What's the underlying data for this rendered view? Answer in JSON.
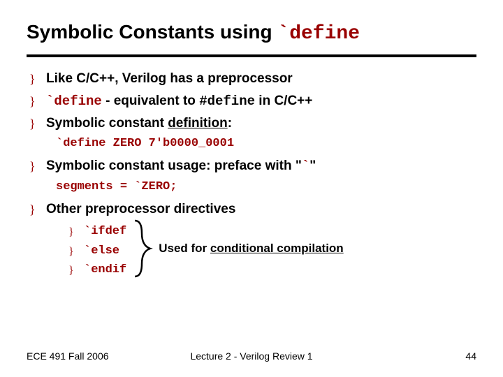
{
  "title": {
    "prefix": "Symbolic Constants using ",
    "code": "`define"
  },
  "bullets": {
    "b1": "Like C/C++, Verilog has a preprocessor",
    "b2": {
      "code1": "`define",
      "mid": " - equivalent to ",
      "code2": "#define",
      "tail": " in C/C++"
    },
    "b3": {
      "pre": "Symbolic constant ",
      "u": "definition",
      "post": ":"
    },
    "code1": "`define ZERO 7'b0000_0001",
    "b4": {
      "pre": "Symbolic constant usage: preface with \"",
      "tick": "`",
      "post": "\""
    },
    "code2": "segments = `ZERO;",
    "b5": "Other preprocessor directives",
    "subs": [
      "`ifdef",
      "`else",
      "`endif"
    ],
    "note": {
      "pre": "Used for ",
      "u": "conditional compilation"
    }
  },
  "footer": {
    "left": "ECE 491 Fall 2006",
    "center": "Lecture 2 - Verilog Review 1",
    "right": "44"
  }
}
